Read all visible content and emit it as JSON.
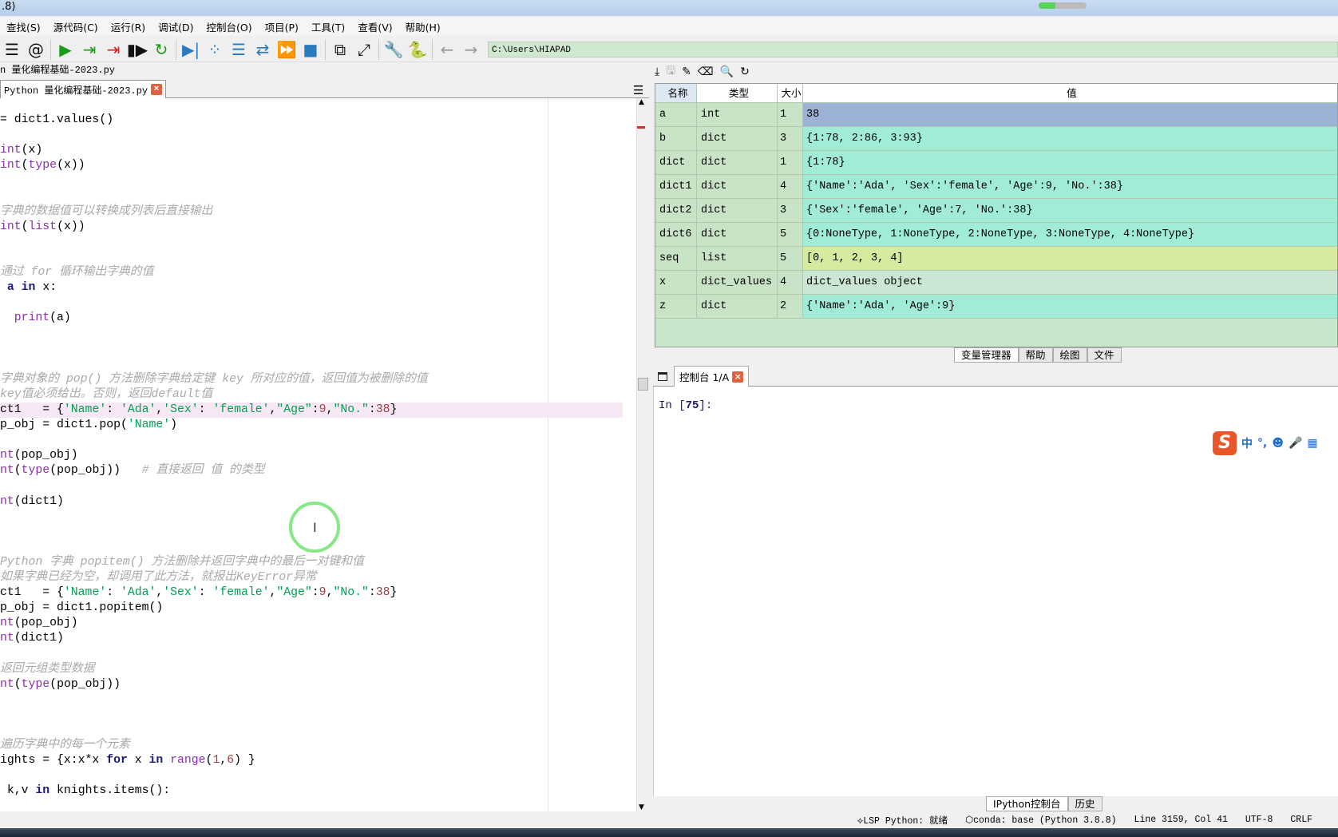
{
  "window": {
    "title_fragment": ".8)",
    "progress_percent": 35
  },
  "menu": [
    "查找(S)",
    "源代码(C)",
    "运行(R)",
    "调试(D)",
    "控制台(O)",
    "项目(P)",
    "工具(T)",
    "查看(V)",
    "帮助(H)"
  ],
  "toolbar": {
    "icons": [
      {
        "name": "list-icon",
        "glyph": "☰",
        "color": "#111"
      },
      {
        "name": "at-icon",
        "glyph": "@",
        "color": "#111"
      },
      {
        "name": "sep"
      },
      {
        "name": "run-icon",
        "glyph": "▶",
        "color": "#1a9a1a"
      },
      {
        "name": "run-cell-icon",
        "glyph": "⇥",
        "color": "#1a9a1a"
      },
      {
        "name": "run-cell-advance-icon",
        "glyph": "⇥",
        "color": "#d02020"
      },
      {
        "name": "run-selection-icon",
        "glyph": "▮▶",
        "color": "#111"
      },
      {
        "name": "rerun-icon",
        "glyph": "↻",
        "color": "#1a9a1a"
      },
      {
        "name": "sep"
      },
      {
        "name": "debug-icon",
        "glyph": "▶|",
        "color": "#2a7ac0"
      },
      {
        "name": "step-icon",
        "glyph": "⁘",
        "color": "#2a7ac0"
      },
      {
        "name": "step-into-icon",
        "glyph": "☰",
        "color": "#2a7ac0"
      },
      {
        "name": "step-return-icon",
        "glyph": "⇄",
        "color": "#2a7ac0"
      },
      {
        "name": "continue-icon",
        "glyph": "⏩",
        "color": "#2a7ac0"
      },
      {
        "name": "stop-icon",
        "glyph": "■",
        "color": "#2a7ac0"
      },
      {
        "name": "sep"
      },
      {
        "name": "maximize-pane-icon",
        "glyph": "⧉",
        "color": "#111"
      },
      {
        "name": "fullscreen-icon",
        "glyph": "⤢",
        "color": "#111"
      },
      {
        "name": "sep"
      },
      {
        "name": "wrench-icon",
        "glyph": "🔧",
        "color": "#111"
      },
      {
        "name": "python-path-icon",
        "glyph": "🐍",
        "color": "#d0a020"
      },
      {
        "name": "sep"
      },
      {
        "name": "back-icon",
        "glyph": "←",
        "color": "#999"
      },
      {
        "name": "forward-icon",
        "glyph": "→",
        "color": "#999"
      }
    ],
    "working_dir": "C:\\Users\\HIAPAD"
  },
  "editor": {
    "file_path": "n 量化编程基础-2023.py",
    "tab_label": "Python 量化编程基础-2023.py",
    "highlight_line": 19,
    "lines": [
      {
        "n": 0,
        "t": [
          [
            "n",
            "= dict1.values()"
          ]
        ]
      },
      {
        "n": 2,
        "t": [
          [
            "bi",
            "int"
          ],
          [
            "n",
            "(x)"
          ]
        ]
      },
      {
        "n": 3,
        "t": [
          [
            "bi",
            "int"
          ],
          [
            "n",
            "("
          ],
          [
            "bi",
            "type"
          ],
          [
            "n",
            "(x))"
          ]
        ]
      },
      {
        "n": 6,
        "t": [
          [
            "com",
            "字典的数据值可以转换成列表后直接输出"
          ]
        ]
      },
      {
        "n": 7,
        "t": [
          [
            "bi",
            "int"
          ],
          [
            "n",
            "("
          ],
          [
            "bi",
            "list"
          ],
          [
            "n",
            "(x))"
          ]
        ]
      },
      {
        "n": 10,
        "t": [
          [
            "com",
            "通过 for 循环输出字典的值"
          ]
        ]
      },
      {
        "n": 11,
        "t": [
          [
            "n",
            " "
          ],
          [
            "kw",
            "a"
          ],
          [
            "n",
            " "
          ],
          [
            "kw",
            "in"
          ],
          [
            "n",
            " x:"
          ]
        ]
      },
      {
        "n": 13,
        "t": [
          [
            "n",
            "  "
          ],
          [
            "bi",
            "print"
          ],
          [
            "n",
            "(a)"
          ]
        ]
      },
      {
        "n": 17,
        "t": [
          [
            "com",
            "字典对象的 pop() 方法删除字典给定键 key 所对应的值，返回值为被删除的值"
          ]
        ]
      },
      {
        "n": 18,
        "t": [
          [
            "com",
            "key值必须给出。否则，返回default值"
          ]
        ]
      },
      {
        "n": 19,
        "t": [
          [
            "n",
            "ct1   = {"
          ],
          [
            "str",
            "'Name'"
          ],
          [
            "n",
            ": "
          ],
          [
            "str",
            "'Ada'"
          ],
          [
            "n",
            ","
          ],
          [
            "str",
            "'Sex'"
          ],
          [
            "n",
            ": "
          ],
          [
            "str",
            "'female'"
          ],
          [
            "n",
            ","
          ],
          [
            "str",
            "\"Age\""
          ],
          [
            "n",
            ":"
          ],
          [
            "num",
            "9"
          ],
          [
            "n",
            ","
          ],
          [
            "str",
            "\"No.\""
          ],
          [
            "n",
            ":"
          ],
          [
            "num",
            "38"
          ],
          [
            "n",
            "}"
          ]
        ]
      },
      {
        "n": 20,
        "t": [
          [
            "n",
            "p_obj = dict1.pop("
          ],
          [
            "str",
            "'Name'"
          ],
          [
            "n",
            ")"
          ]
        ]
      },
      {
        "n": 22,
        "t": [
          [
            "bi",
            "nt"
          ],
          [
            "n",
            "(pop_obj)"
          ]
        ]
      },
      {
        "n": 23,
        "t": [
          [
            "bi",
            "nt"
          ],
          [
            "n",
            "("
          ],
          [
            "bi",
            "type"
          ],
          [
            "n",
            "(pop_obj))   "
          ],
          [
            "com",
            "# 直接返回 值 的类型"
          ]
        ]
      },
      {
        "n": 25,
        "t": [
          [
            "bi",
            "nt"
          ],
          [
            "n",
            "(dict1)"
          ]
        ]
      },
      {
        "n": 29,
        "t": [
          [
            "com",
            "Python 字典 popitem() 方法删除并返回字典中的最后一对键和值"
          ]
        ]
      },
      {
        "n": 30,
        "t": [
          [
            "com",
            "如果字典已经为空，却调用了此方法，就报出KeyError异常"
          ]
        ]
      },
      {
        "n": 31,
        "t": [
          [
            "n",
            "ct1   = {"
          ],
          [
            "str",
            "'Name'"
          ],
          [
            "n",
            ": "
          ],
          [
            "str",
            "'Ada'"
          ],
          [
            "n",
            ","
          ],
          [
            "str",
            "'Sex'"
          ],
          [
            "n",
            ": "
          ],
          [
            "str",
            "'female'"
          ],
          [
            "n",
            ","
          ],
          [
            "str",
            "\"Age\""
          ],
          [
            "n",
            ":"
          ],
          [
            "num",
            "9"
          ],
          [
            "n",
            ","
          ],
          [
            "str",
            "\"No.\""
          ],
          [
            "n",
            ":"
          ],
          [
            "num",
            "38"
          ],
          [
            "n",
            "}"
          ]
        ]
      },
      {
        "n": 32,
        "t": [
          [
            "n",
            "p_obj = dict1.popitem()"
          ]
        ]
      },
      {
        "n": 33,
        "t": [
          [
            "bi",
            "nt"
          ],
          [
            "n",
            "(pop_obj)"
          ]
        ]
      },
      {
        "n": 34,
        "t": [
          [
            "bi",
            "nt"
          ],
          [
            "n",
            "(dict1)"
          ]
        ]
      },
      {
        "n": 36,
        "t": [
          [
            "com",
            "返回元组类型数据"
          ]
        ]
      },
      {
        "n": 37,
        "t": [
          [
            "bi",
            "nt"
          ],
          [
            "n",
            "("
          ],
          [
            "bi",
            "type"
          ],
          [
            "n",
            "(pop_obj))"
          ]
        ]
      },
      {
        "n": 41,
        "t": [
          [
            "com",
            "遍历字典中的每一个元素"
          ]
        ]
      },
      {
        "n": 42,
        "t": [
          [
            "n",
            "ights = {x:x*x "
          ],
          [
            "kw",
            "for"
          ],
          [
            "n",
            " x "
          ],
          [
            "kw",
            "in"
          ],
          [
            "n",
            " "
          ],
          [
            "bi",
            "range"
          ],
          [
            "n",
            "("
          ],
          [
            "num",
            "1"
          ],
          [
            "n",
            ","
          ],
          [
            "num",
            "6"
          ],
          [
            "n",
            ") }"
          ]
        ]
      },
      {
        "n": 44,
        "t": [
          [
            "n",
            " k,v "
          ],
          [
            "kw",
            "in"
          ],
          [
            "n",
            " knights.items():"
          ]
        ]
      }
    ]
  },
  "variable_explorer": {
    "tool_icons": [
      "import-data-icon",
      "save-data-icon",
      "save-as-icon",
      "erase-icon",
      "search-icon",
      "refresh-icon"
    ],
    "headers": [
      "名称",
      "类型",
      "大小",
      "值"
    ],
    "rows": [
      {
        "name": "a",
        "type": "int",
        "size": "1",
        "value": "38",
        "color": "#9db3d5"
      },
      {
        "name": "b",
        "type": "dict",
        "size": "3",
        "value": "{1:78, 2:86, 3:93}",
        "color": "#a0ecd6"
      },
      {
        "name": "dict",
        "type": "dict",
        "size": "1",
        "value": "{1:78}",
        "color": "#a0ecd6"
      },
      {
        "name": "dict1",
        "type": "dict",
        "size": "4",
        "value": "{'Name':'Ada', 'Sex':'female', 'Age':9, 'No.':38}",
        "color": "#a0ecd6"
      },
      {
        "name": "dict2",
        "type": "dict",
        "size": "3",
        "value": "{'Sex':'female', 'Age':7, 'No.':38}",
        "color": "#a0ecd6"
      },
      {
        "name": "dict6",
        "type": "dict",
        "size": "5",
        "value": "{0:NoneType, 1:NoneType, 2:NoneType, 3:NoneType, 4:NoneType}",
        "color": "#a0ecd6"
      },
      {
        "name": "seq",
        "type": "list",
        "size": "5",
        "value": "[0, 1, 2, 3, 4]",
        "color": "#d6eaa0"
      },
      {
        "name": "x",
        "type": "dict_values",
        "size": "4",
        "value": "dict_values object",
        "color": "#cbe7d3"
      },
      {
        "name": "z",
        "type": "dict",
        "size": "2",
        "value": "{'Name':'Ada', 'Age':9}",
        "color": "#a0ecd6"
      }
    ]
  },
  "pane_tabs": [
    "变量管理器",
    "帮助",
    "绘图",
    "文件"
  ],
  "console": {
    "tab_label": "控制台 1/A",
    "prompt_prefix": "In [",
    "prompt_number": "75",
    "prompt_suffix": "]:"
  },
  "ime": {
    "logo": "S",
    "items": [
      "中",
      "°,",
      "☻",
      "🎤",
      "▦"
    ]
  },
  "bottom_tabs": [
    "IPython控制台",
    "历史"
  ],
  "status": [
    "LSP Python: 就绪",
    "conda: base (Python 3.8.8)",
    "Line 3159, Col 41",
    "UTF-8",
    "CRLF"
  ]
}
